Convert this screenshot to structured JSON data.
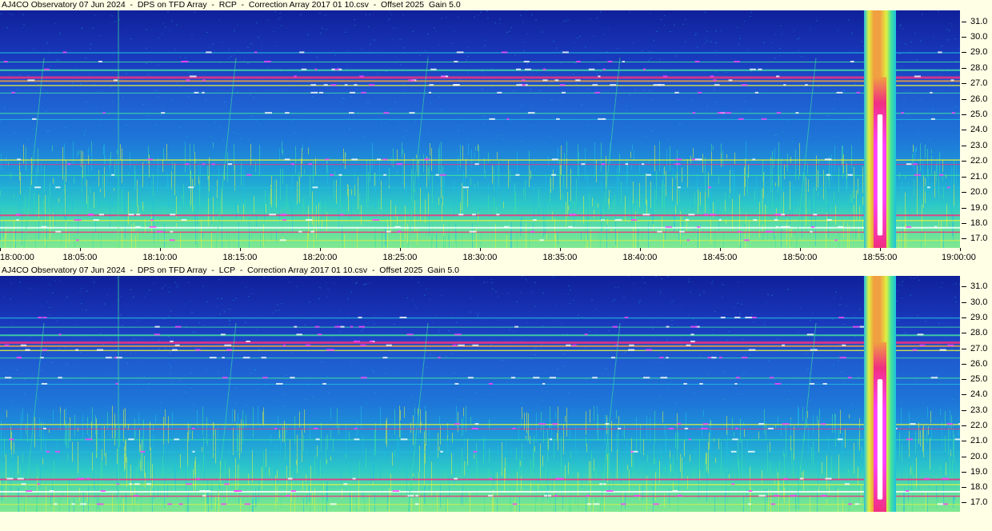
{
  "panels": [
    {
      "title": "AJ4CO Observatory 07 Jun 2024  -  DPS on TFD Array  -  RCP  -  Correction Array 2017 01 10.csv  -  Offset 2025  Gain 5.0"
    },
    {
      "title": "AJ4CO Observatory 07 Jun 2024  -  DPS on TFD Array  -  LCP  -  Correction Array 2017 01 10.csv  -  Offset 2025  Gain 5.0"
    }
  ],
  "chart_data": [
    {
      "type": "heatmap",
      "title": "AJ4CO Observatory 07 Jun 2024  -  DPS on TFD Array  -  RCP  -  Correction Array 2017 01 10.csv  -  Offset 2025  Gain 5.0",
      "x_ticks": [
        "18:00:00",
        "18:05:00",
        "18:10:00",
        "18:15:00",
        "18:20:00",
        "18:25:00",
        "18:30:00",
        "18:35:00",
        "18:40:00",
        "18:45:00",
        "18:50:00",
        "18:55:00",
        "19:00:00"
      ],
      "y_ticks": [
        "31.0",
        "30.0",
        "29.0",
        "28.0",
        "27.0",
        "26.0",
        "25.0",
        "24.0",
        "23.0",
        "22.0",
        "21.0",
        "20.0",
        "19.0",
        "18.0",
        "17.0"
      ],
      "xlim": [
        "18:00:00",
        "19:00:00"
      ],
      "ylim": [
        16.4,
        31.7
      ],
      "colormap": [
        "#1020a0",
        "#1e4fd0",
        "#1e7fe0",
        "#1ec0e0",
        "#40e0a0",
        "#e0f040",
        "#f0a040",
        "#f03080",
        "#ff40ff",
        "#ffffff"
      ],
      "burst": {
        "time_start": "18:54:00",
        "time_end": "18:56:00"
      }
    },
    {
      "type": "heatmap",
      "title": "AJ4CO Observatory 07 Jun 2024  -  DPS on TFD Array  -  LCP  -  Correction Array 2017 01 10.csv  -  Offset 2025  Gain 5.0",
      "x_ticks": [],
      "y_ticks": [
        "31.0",
        "30.0",
        "29.0",
        "28.0",
        "27.0",
        "26.0",
        "25.0",
        "24.0",
        "23.0",
        "22.0",
        "21.0",
        "20.0",
        "19.0",
        "18.0",
        "17.0"
      ],
      "xlim": [
        "18:00:00",
        "19:00:00"
      ],
      "ylim": [
        16.4,
        31.7
      ],
      "colormap": [
        "#1020a0",
        "#1e4fd0",
        "#1e7fe0",
        "#1ec0e0",
        "#40e0a0",
        "#e0f040",
        "#f0a040",
        "#f03080",
        "#ff40ff",
        "#ffffff"
      ],
      "burst": {
        "time_start": "18:54:00",
        "time_end": "18:56:00"
      }
    }
  ]
}
